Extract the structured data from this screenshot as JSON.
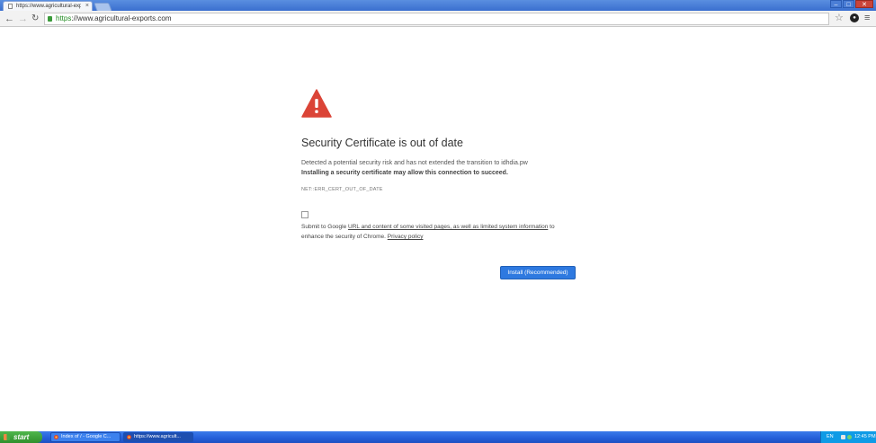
{
  "browser": {
    "tab_title": "https://www.agricultural-exp",
    "tab_close": "×",
    "url_scheme": "https",
    "url_rest": "://www.agricultural-exports.com",
    "window_controls": [
      "‒",
      "□",
      "✕"
    ]
  },
  "interstitial": {
    "heading": "Security Certificate is out of date",
    "line1": "Detected a potential security risk and has not extended the transition to idhdia.pw",
    "line2": "Installing a security certificate may allow this connection to succeed.",
    "error_code": "NET::ERR_CERT_OUT_OF_DATE",
    "report_prefix": "Submit to Google ",
    "report_link1": "URL and content of some visited pages, as well as limited system information",
    "report_suffix": " to enhance the security of Chrome. ",
    "privacy_link": "Privacy policy",
    "install_button": "Install (Recommended)",
    "icon_color": "#db4437"
  },
  "taskbar": {
    "start_label": "start",
    "tasks": [
      {
        "label": "Index of / - Google C..."
      },
      {
        "label": "https://www.agricult..."
      }
    ],
    "language": "EN",
    "clock": "12:45 PM"
  }
}
